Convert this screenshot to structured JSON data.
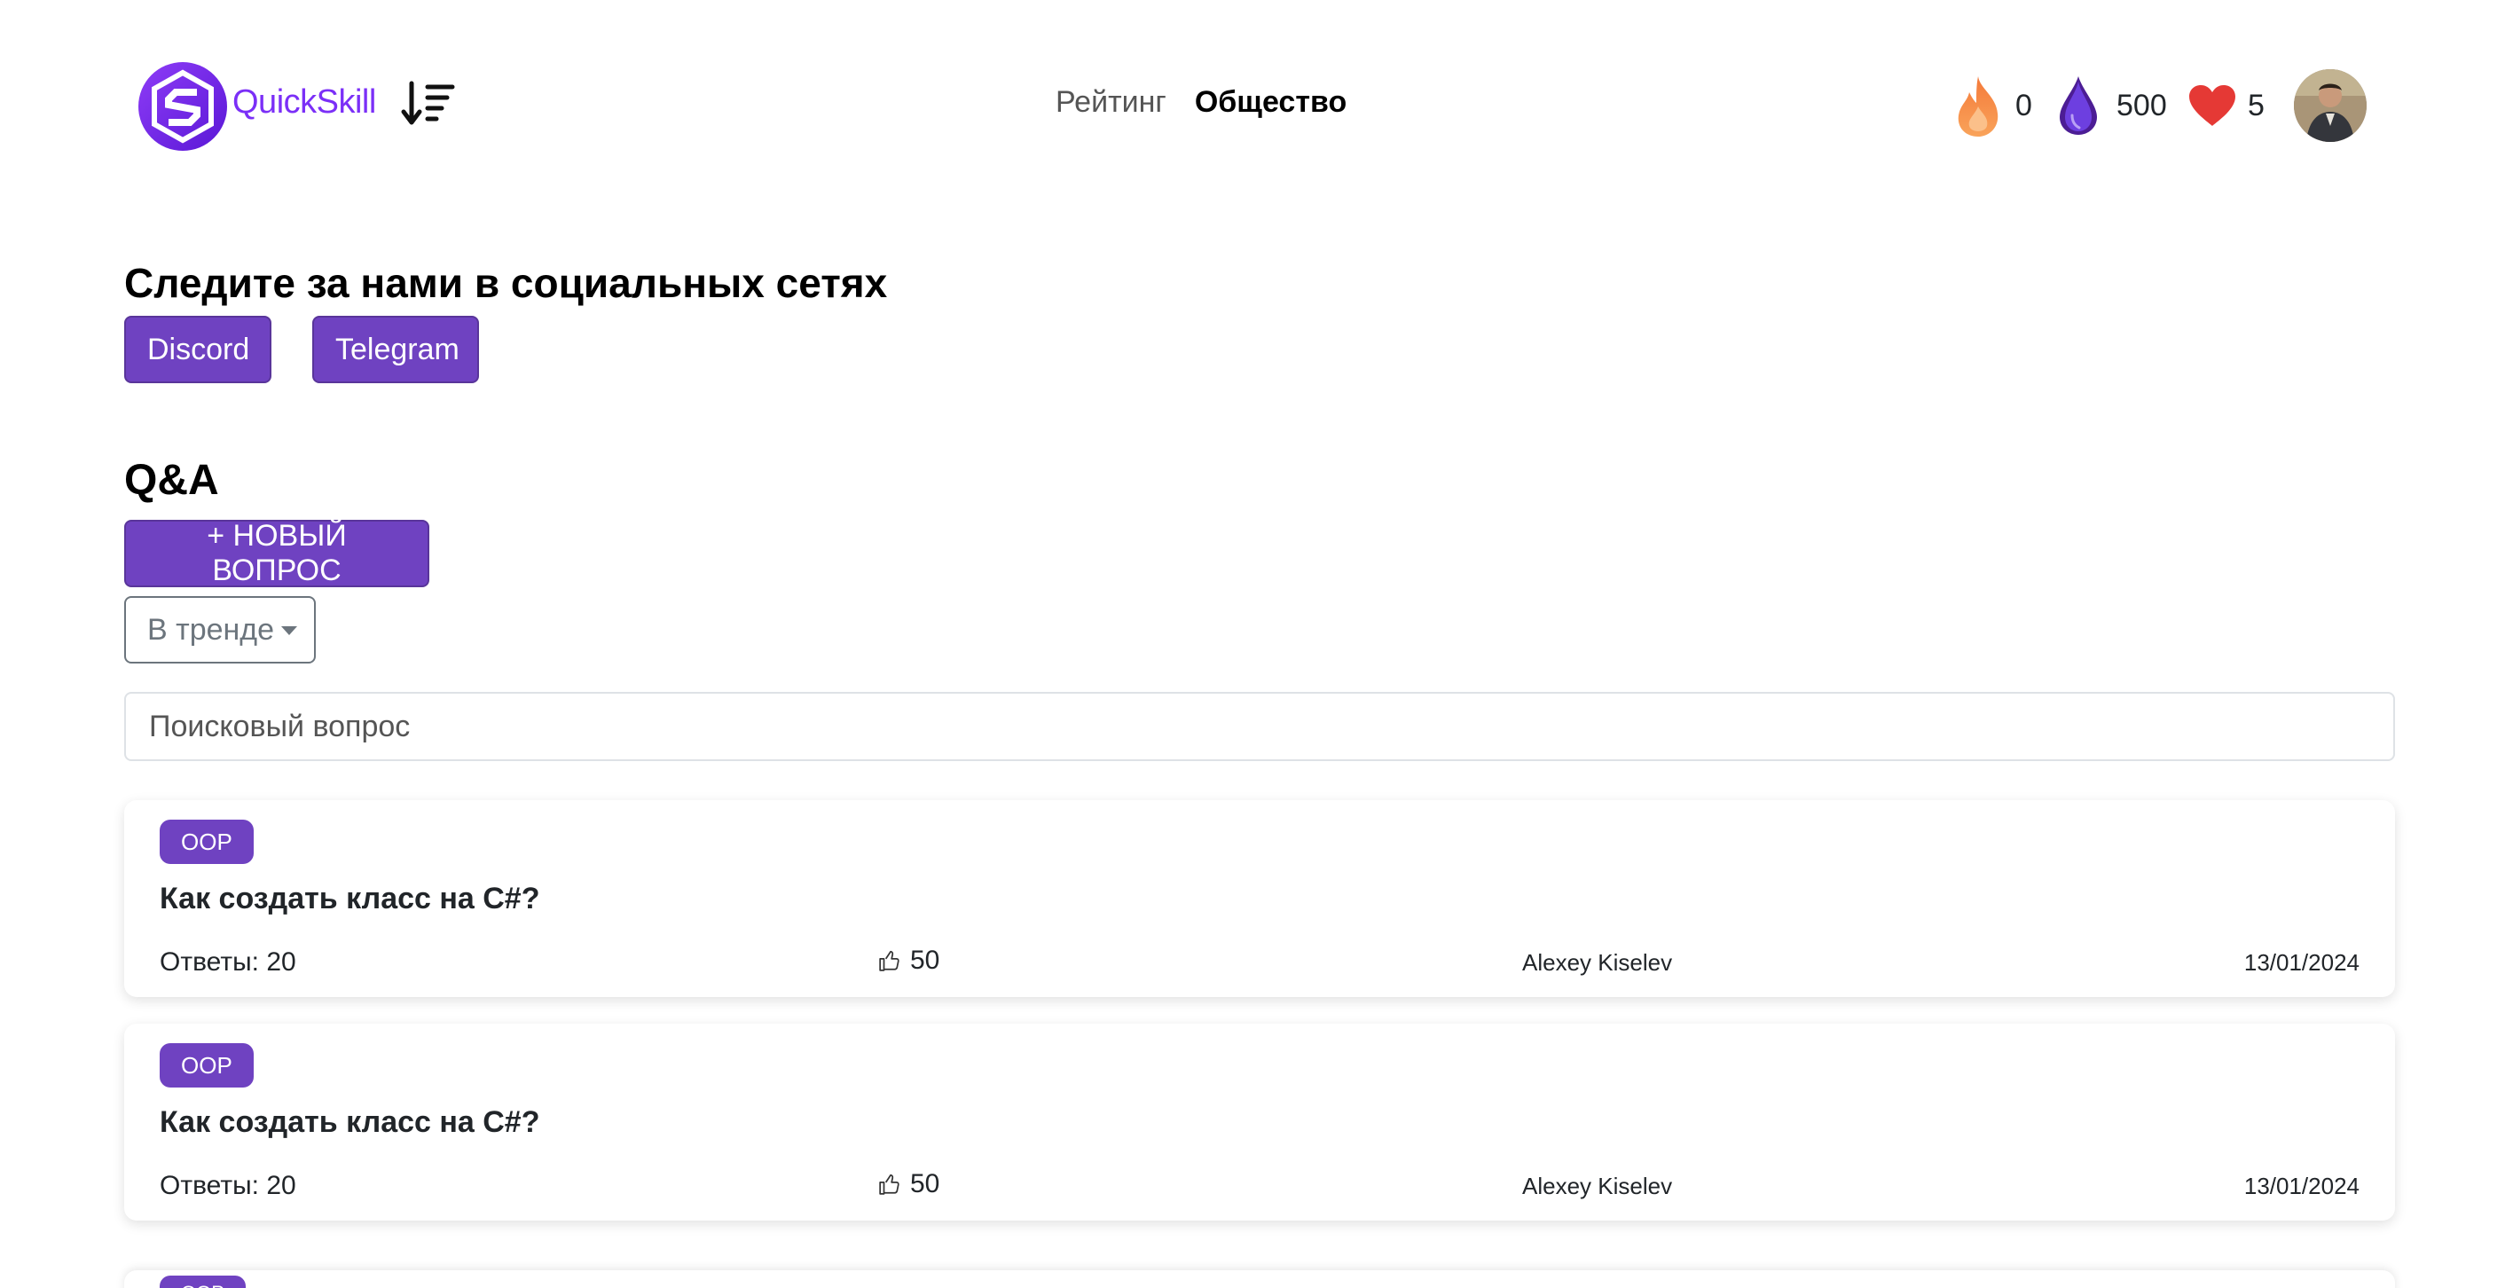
{
  "header": {
    "brand": "QuickSkill",
    "nav": [
      {
        "label": "Рейтинг",
        "active": false
      },
      {
        "label": "Общество",
        "active": true
      }
    ],
    "stats": {
      "streak": "0",
      "gems": "500",
      "lives": "5"
    },
    "icons": {
      "sort": "sort-descending-icon",
      "streak": "flame-icon",
      "gems": "water-drop-icon",
      "lives": "heart-icon"
    },
    "colors": {
      "brand": "#7b2ff7",
      "flame": "#f08a4b",
      "gem": "#5b21b6",
      "heart": "#e53935"
    }
  },
  "social": {
    "title": "Следите за нами в социальных сетях",
    "discord_label": "Discord",
    "telegram_label": "Telegram"
  },
  "qa": {
    "title": "Q&A",
    "new_question_label": "+ НОВЫЙ ВОПРОС",
    "filter_label": "В тренде",
    "search_placeholder": "Поисковый вопрос"
  },
  "questions": [
    {
      "tag": "OOP",
      "title": "Как создать класс на C#?",
      "answers": "Ответы: 20",
      "likes": "50",
      "author": "Alexey Kiselev",
      "date": "13/01/2024"
    },
    {
      "tag": "OOP",
      "title": "Как создать класс на C#?",
      "answers": "Ответы: 20",
      "likes": "50",
      "author": "Alexey Kiselev",
      "date": "13/01/2024"
    },
    {
      "tag": "OOP"
    }
  ],
  "theme": {
    "primary": "#6f42c1",
    "primary_border": "#59359a"
  }
}
